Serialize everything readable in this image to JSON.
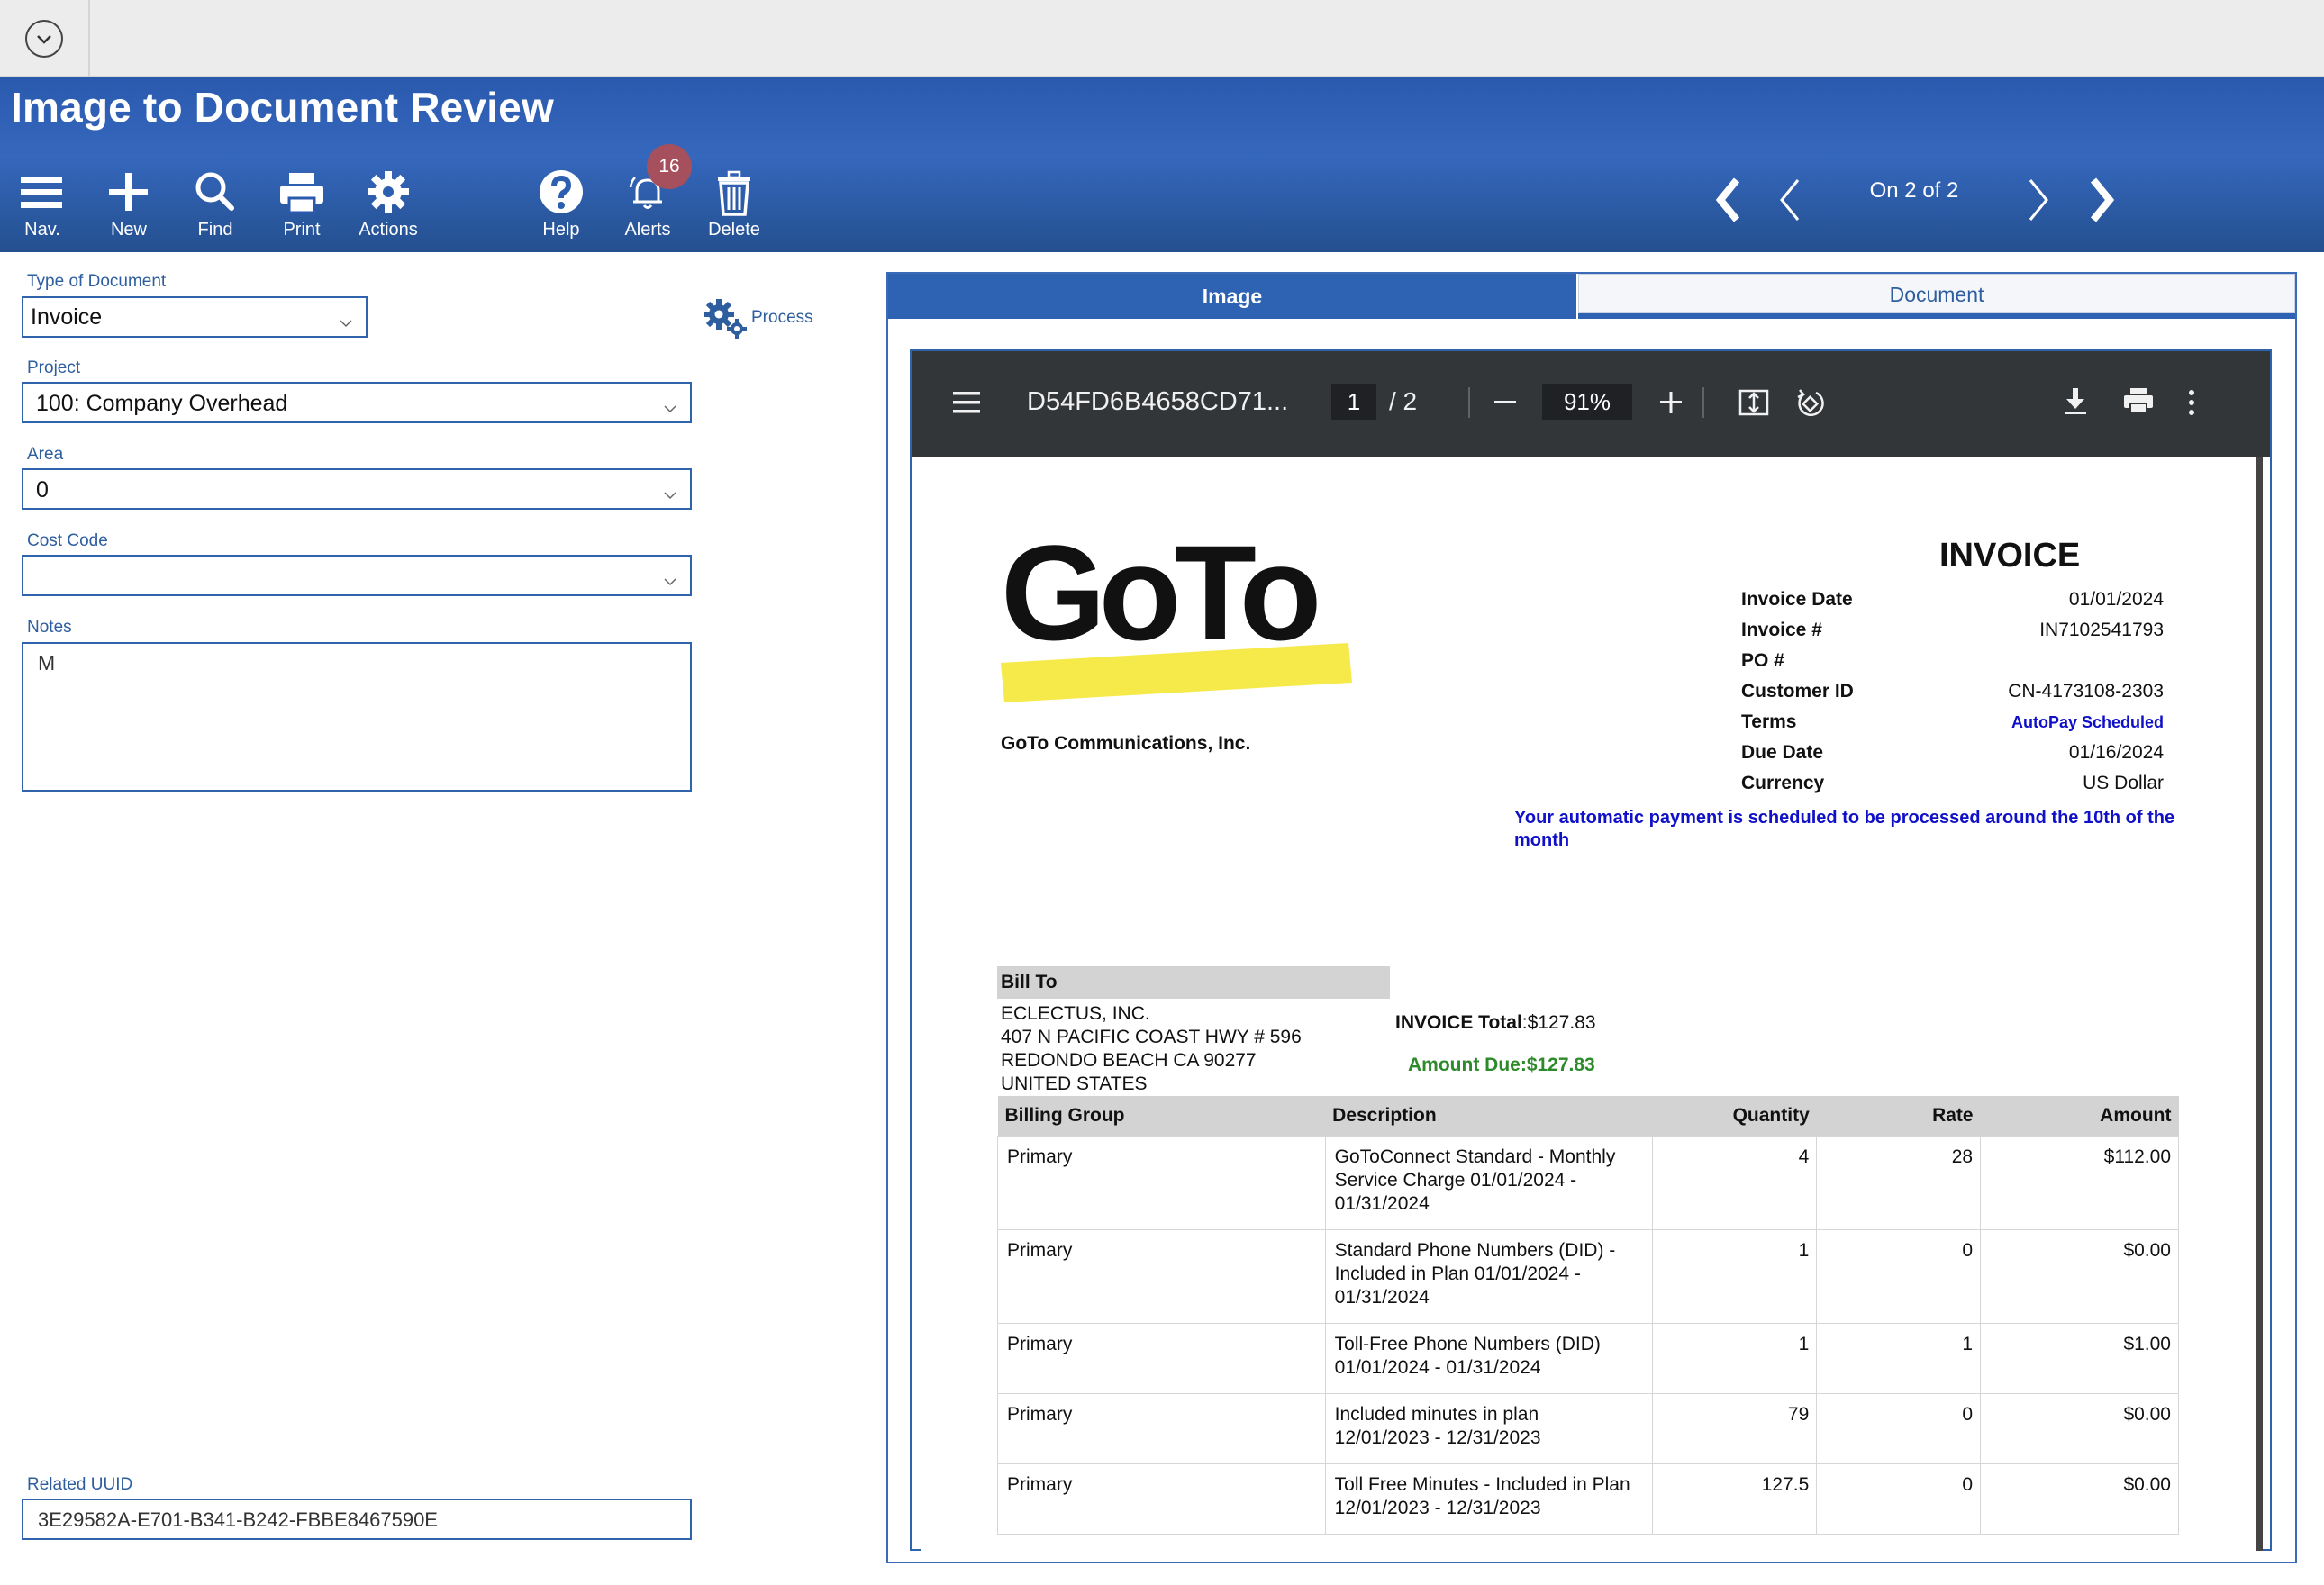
{
  "app": {
    "title": "Image to Document Review"
  },
  "toolbar": {
    "nav": "Nav.",
    "new": "New",
    "find": "Find",
    "print": "Print",
    "actions": "Actions",
    "help": "Help",
    "alerts": "Alerts",
    "alerts_count": "16",
    "delete": "Delete"
  },
  "pager": {
    "text": "On 2 of 2"
  },
  "form": {
    "type_label": "Type of Document",
    "type_value": "Invoice",
    "process_label": "Process",
    "project_label": "Project",
    "project_value": "100: Company Overhead",
    "area_label": "Area",
    "area_value": "0",
    "cost_code_label": "Cost Code",
    "cost_code_value": "",
    "notes_label": "Notes",
    "notes_value": "M",
    "uuid_label": "Related UUID",
    "uuid_value": "3E29582A-E701-B341-B242-FBBE8467590E"
  },
  "viewer": {
    "tabs": {
      "image": "Image",
      "document": "Document"
    },
    "pdf": {
      "filename": "D54FD6B4658CD71...",
      "page": "1",
      "page_sep": "/  2",
      "zoom": "91%"
    }
  },
  "invoice": {
    "heading": "INVOICE",
    "logo_text": "GoTo",
    "company": "GoTo Communications, Inc.",
    "meta": [
      {
        "k": "Invoice Date",
        "v": "01/01/2024"
      },
      {
        "k": "Invoice #",
        "v": "IN7102541793"
      },
      {
        "k": "PO #",
        "v": ""
      },
      {
        "k": "Customer ID",
        "v": "CN-4173108-2303"
      },
      {
        "k": "Terms",
        "v": "AutoPay Scheduled"
      },
      {
        "k": "Due Date",
        "v": "01/16/2024"
      },
      {
        "k": "Currency",
        "v": "US Dollar"
      }
    ],
    "autopay_note": "Your automatic payment is scheduled to be processed around the 10th of the month",
    "bill_to": {
      "heading": "Bill To",
      "lines": [
        "ECLECTUS, INC.",
        "407 N PACIFIC COAST HWY # 596",
        "REDONDO BEACH CA 90277",
        "UNITED STATES"
      ]
    },
    "total_label": "INVOICE Total",
    "total_value": ":$127.83",
    "amount_due": "Amount Due:$127.83",
    "table": {
      "headers": [
        "Billing Group",
        "Description",
        "Quantity",
        "Rate",
        "Amount"
      ],
      "rows": [
        {
          "group": "Primary",
          "desc": [
            "GoToConnect Standard - Monthly",
            "Service Charge 01/01/2024 -",
            "01/31/2024"
          ],
          "qty": "4",
          "rate": "28",
          "amount": "$112.00"
        },
        {
          "group": "Primary",
          "desc": [
            "Standard Phone Numbers (DID) -",
            "Included in Plan 01/01/2024 -",
            "01/31/2024"
          ],
          "qty": "1",
          "rate": "0",
          "amount": "$0.00"
        },
        {
          "group": "Primary",
          "desc": [
            "Toll-Free Phone Numbers (DID)",
            "01/01/2024 - 01/31/2024"
          ],
          "qty": "1",
          "rate": "1",
          "amount": "$1.00"
        },
        {
          "group": "Primary",
          "desc": [
            "Included minutes in plan",
            "12/01/2023 - 12/31/2023"
          ],
          "qty": "79",
          "rate": "0",
          "amount": "$0.00"
        },
        {
          "group": "Primary",
          "desc": [
            "Toll Free Minutes - Included in Plan",
            "12/01/2023 - 12/31/2023"
          ],
          "qty": "127.5",
          "rate": "0",
          "amount": "$0.00"
        }
      ]
    }
  }
}
